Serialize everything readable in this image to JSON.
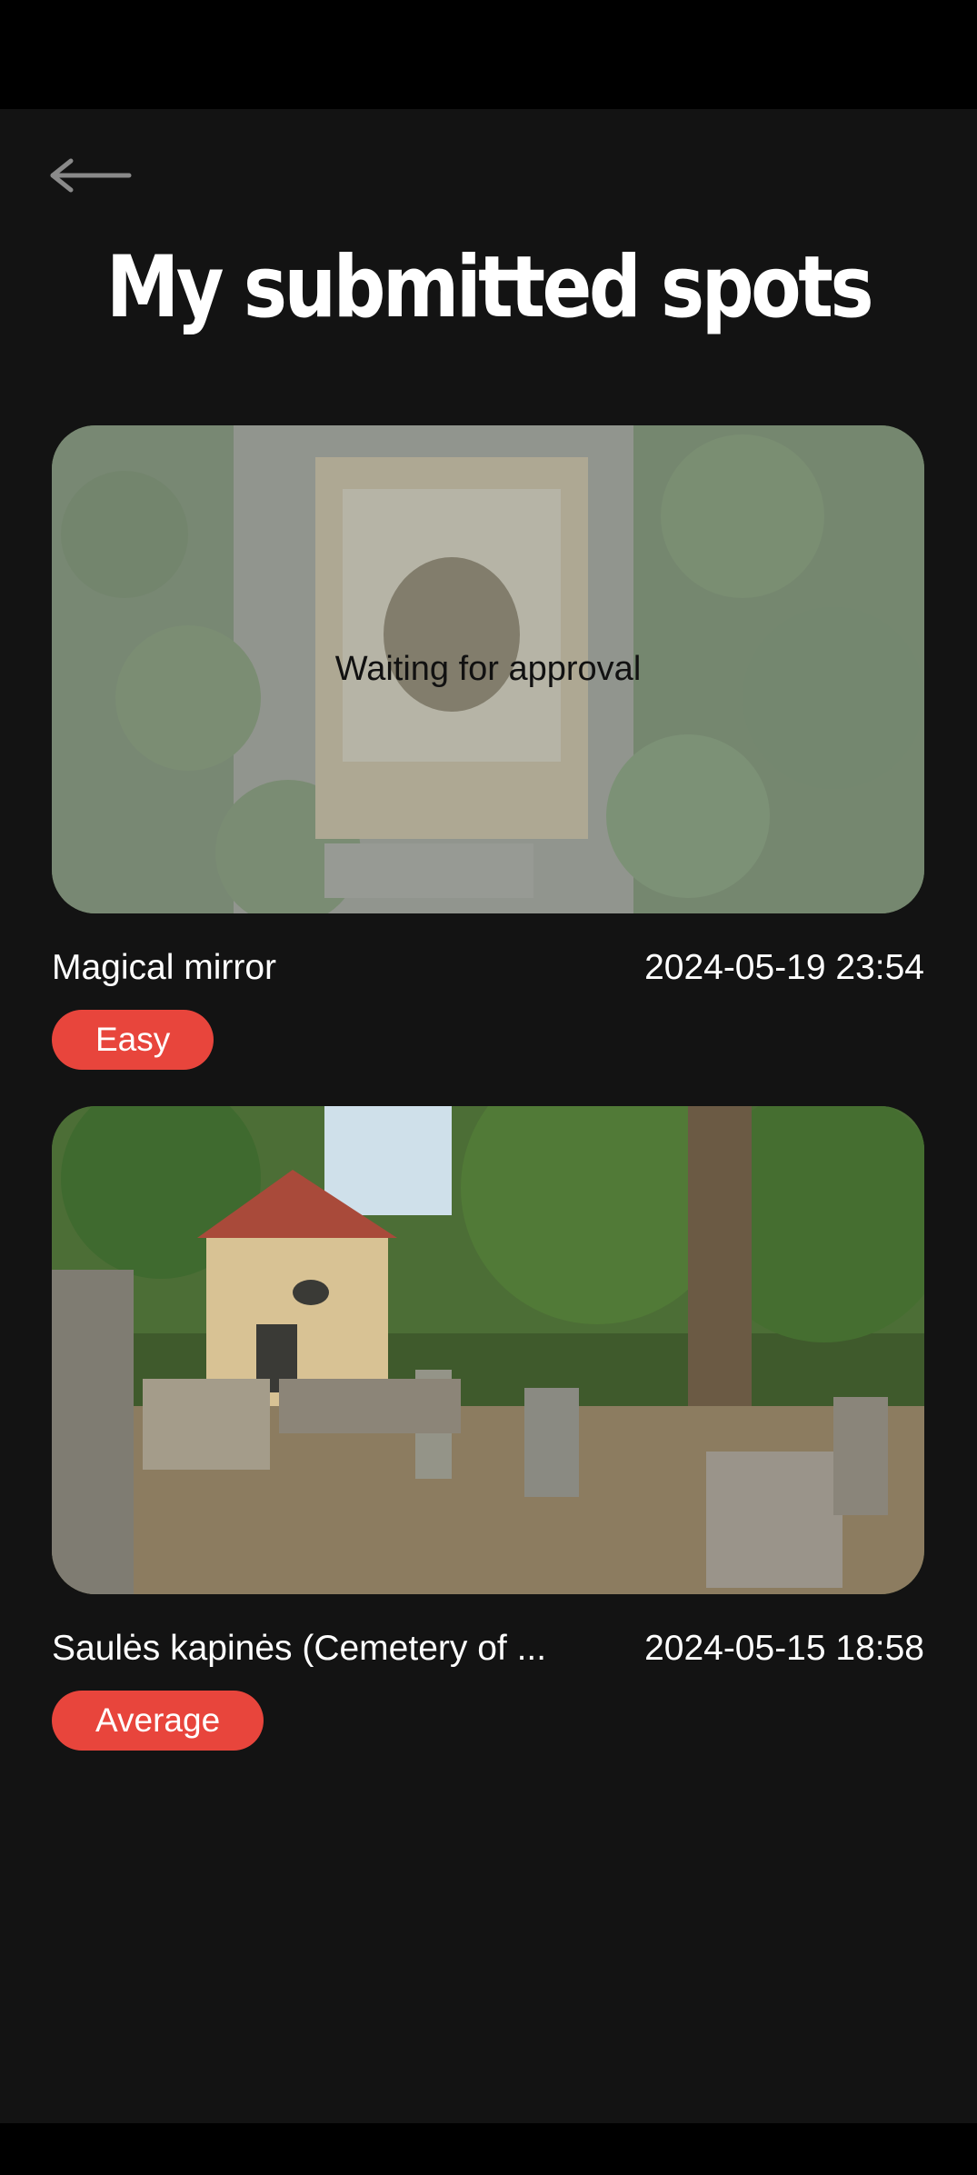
{
  "header": {
    "back_icon": "arrow-left-icon",
    "title": "My submitted spots"
  },
  "spots": [
    {
      "name": "Magical mirror",
      "date": "2024-05-19 23:54",
      "difficulty": "Easy",
      "status": "Waiting for approval"
    },
    {
      "name": "Saulės kapinės (Cemetery of ...",
      "date": "2024-05-15 18:58",
      "difficulty": "Average"
    }
  ],
  "colors": {
    "background": "#131313",
    "badge": "#e8453c"
  }
}
